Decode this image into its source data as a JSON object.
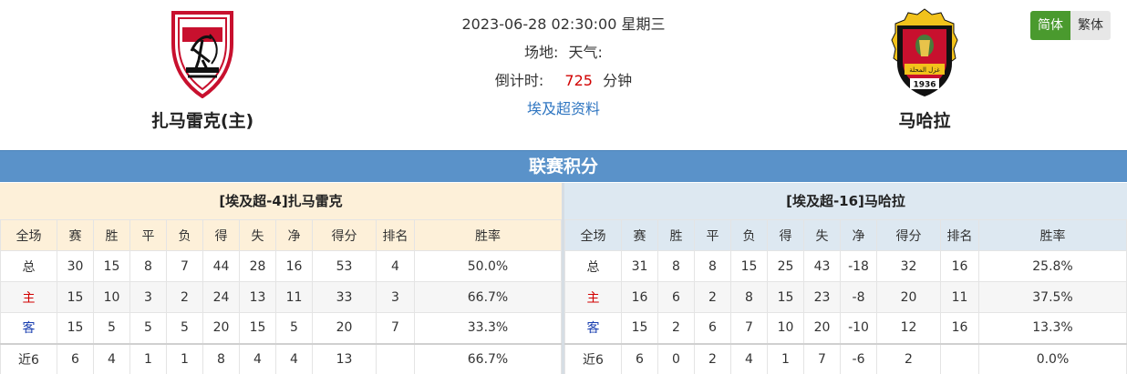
{
  "match": {
    "datetime": "2023-06-28 02:30:00",
    "weekday": "星期三",
    "venue_label": "场地:",
    "weather_label": "天气:",
    "countdown_label": "倒计时:",
    "countdown_value": "725",
    "countdown_unit": "分钟",
    "league_link": "埃及超资料"
  },
  "home_team": {
    "name": "扎马雷克(主)"
  },
  "away_team": {
    "name": "马哈拉"
  },
  "lang": {
    "simplified": "简体",
    "traditional": "繁体"
  },
  "section_title": "联赛积分",
  "colors": {
    "header_bar": "#5a92c9",
    "home_panel": "#fdf0d9",
    "away_panel": "#dde8f1",
    "countdown": "#d10000",
    "lang_active": "#4a9a2e",
    "link": "#2f76c1"
  },
  "columns": [
    "全场",
    "赛",
    "胜",
    "平",
    "负",
    "得",
    "失",
    "净",
    "得分",
    "排名",
    "胜率"
  ],
  "home_table": {
    "title": "[埃及超-4]扎马雷克",
    "rows": [
      [
        "总",
        "30",
        "15",
        "8",
        "7",
        "44",
        "28",
        "16",
        "53",
        "4",
        "50.0%"
      ],
      [
        "主",
        "15",
        "10",
        "3",
        "2",
        "24",
        "13",
        "11",
        "33",
        "3",
        "66.7%"
      ],
      [
        "客",
        "15",
        "5",
        "5",
        "5",
        "20",
        "15",
        "5",
        "20",
        "7",
        "33.3%"
      ],
      [
        "近6",
        "6",
        "4",
        "1",
        "1",
        "8",
        "4",
        "4",
        "13",
        "",
        "66.7%"
      ]
    ]
  },
  "away_table": {
    "title": "[埃及超-16]马哈拉",
    "rows": [
      [
        "总",
        "31",
        "8",
        "8",
        "15",
        "25",
        "43",
        "-18",
        "32",
        "16",
        "25.8%"
      ],
      [
        "主",
        "16",
        "6",
        "2",
        "8",
        "15",
        "23",
        "-8",
        "20",
        "11",
        "37.5%"
      ],
      [
        "客",
        "15",
        "2",
        "6",
        "7",
        "10",
        "20",
        "-10",
        "12",
        "16",
        "13.3%"
      ],
      [
        "近6",
        "6",
        "0",
        "2",
        "4",
        "1",
        "7",
        "-6",
        "2",
        "",
        "0.0%"
      ]
    ]
  },
  "logo_text": {
    "away_arabic": "غزل المحلة",
    "away_year": "1936"
  }
}
